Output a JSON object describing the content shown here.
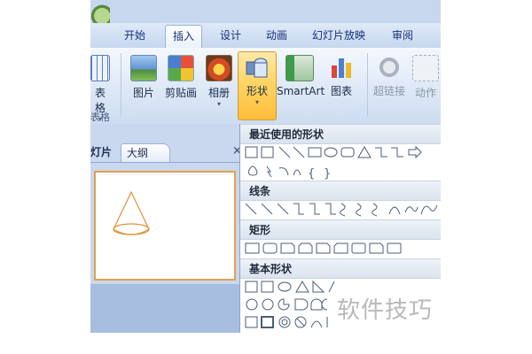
{
  "tabs": [
    {
      "label": "开始"
    },
    {
      "label": "插入"
    },
    {
      "label": "设计"
    },
    {
      "label": "动画"
    },
    {
      "label": "幻灯片放映"
    },
    {
      "label": "审阅"
    }
  ],
  "active_tab": "插入",
  "ribbon": {
    "buttons": [
      {
        "label": "表格"
      },
      {
        "label": "图片"
      },
      {
        "label": "剪贴画"
      },
      {
        "label": "相册"
      },
      {
        "label": "形状"
      },
      {
        "label": "SmartArt"
      },
      {
        "label": "图表"
      },
      {
        "label": "超链接"
      },
      {
        "label": "动作"
      }
    ],
    "group_labels": [
      "表格",
      "插"
    ]
  },
  "left_panel": {
    "tab_slides": "灯片",
    "tab_outline": "大纲",
    "close_glyph": "×"
  },
  "dropdown": {
    "sections": [
      {
        "title": "最近使用的形状"
      },
      {
        "title": "线条"
      },
      {
        "title": "矩形"
      },
      {
        "title": "基本形状"
      }
    ],
    "brace_left": "{",
    "brace_right": "}"
  },
  "watermark": "软件技巧",
  "colors": {
    "accent_active": "#ffd567",
    "cone_stroke": "#e0913a",
    "ribbon_bg": "#dbe7f6"
  }
}
